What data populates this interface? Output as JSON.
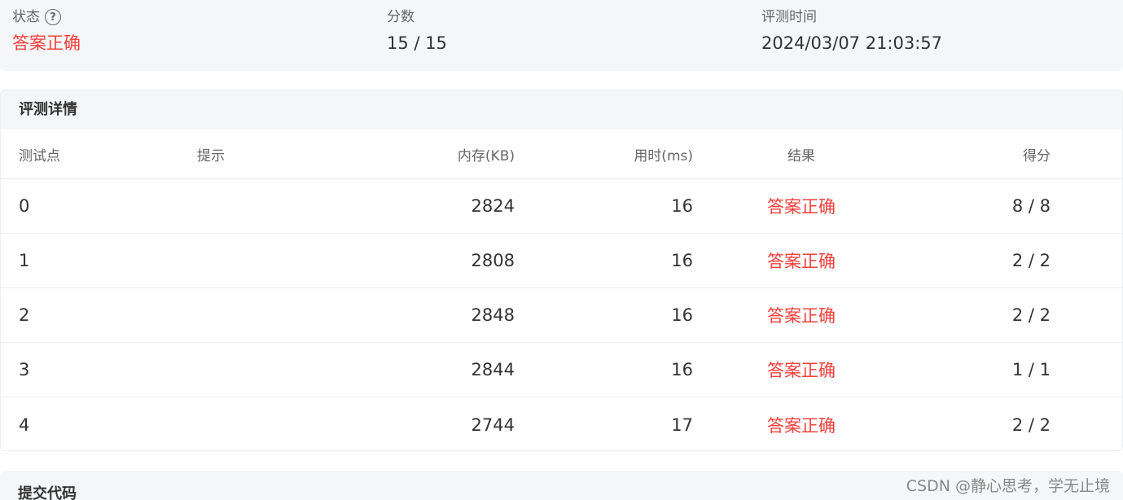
{
  "summary": {
    "status_label": "状态",
    "status_help_icon": "question-circle-icon",
    "status_help_glyph": "?",
    "status_value": "答案正确",
    "score_label": "分数",
    "score_value": "15 / 15",
    "time_label": "评测时间",
    "time_value": "2024/03/07 21:03:57"
  },
  "details": {
    "title": "评测详情",
    "columns": {
      "testpoint": "测试点",
      "hint": "提示",
      "memory": "内存(KB)",
      "time": "用时(ms)",
      "result": "结果",
      "score": "得分"
    },
    "rows": [
      {
        "id": "0",
        "hint": "",
        "memory": "2824",
        "time": "16",
        "result": "答案正确",
        "score": "8 / 8"
      },
      {
        "id": "1",
        "hint": "",
        "memory": "2808",
        "time": "16",
        "result": "答案正确",
        "score": "2 / 2"
      },
      {
        "id": "2",
        "hint": "",
        "memory": "2848",
        "time": "16",
        "result": "答案正确",
        "score": "2 / 2"
      },
      {
        "id": "3",
        "hint": "",
        "memory": "2844",
        "time": "16",
        "result": "答案正确",
        "score": "1 / 1"
      },
      {
        "id": "4",
        "hint": "",
        "memory": "2744",
        "time": "17",
        "result": "答案正确",
        "score": "2 / 2"
      }
    ]
  },
  "code": {
    "title": "提交代码"
  },
  "watermark": "CSDN @静心思考，学无止境",
  "colors": {
    "accepted": "#f1403c",
    "panel_bg": "#f5f6f7"
  }
}
